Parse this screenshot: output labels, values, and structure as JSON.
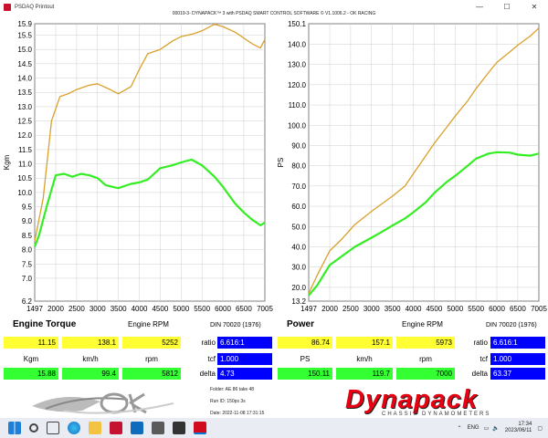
{
  "window": {
    "title": "PSDAQ Printout",
    "controls": [
      "—",
      "☐",
      "✕"
    ]
  },
  "header": {
    "text": "00019-3- DYNAPACK™ 3 with PSDAQ SMART CONTROL SOFTWARE © V1.1006.2 - OK RACING"
  },
  "torque_section": {
    "title": "Engine Torque",
    "xlabel": "Engine RPM",
    "din": "DIN 70020 (1976)",
    "row1": {
      "value": "11.15",
      "kmh": "138.1",
      "rpm": "5252",
      "ratio_label": "ratio",
      "ratio": "6.616:1"
    },
    "units": {
      "u1": "Kgm",
      "u2": "km/h",
      "u3": "rpm",
      "tcf_label": "tcf",
      "tcf": "1.000"
    },
    "row2": {
      "value": "15.88",
      "kmh": "99.4",
      "rpm": "5812",
      "delta_label": "delta",
      "delta": "4.73"
    }
  },
  "power_section": {
    "title": "Power",
    "xlabel": "Engine RPM",
    "din": "DIN 70020 (1976)",
    "row1": {
      "value": "86.74",
      "kmh": "157.1",
      "rpm": "5973",
      "ratio_label": "ratio",
      "ratio": "6.616:1"
    },
    "units": {
      "u1": "PS",
      "u2": "km/h",
      "u3": "rpm",
      "tcf_label": "tcf",
      "tcf": "1.000"
    },
    "row2": {
      "value": "150.11",
      "kmh": "119.7",
      "rpm": "7000",
      "delta_label": "delta",
      "delta": "63.37"
    }
  },
  "footer": {
    "folder": "Folder:   AE 86 take 48",
    "run": "Run ID:   150ps 3s",
    "date": "Date:    2022-11-08 17:31:15",
    "logo_right": "Dynapack",
    "logo_right_sub": "CHASSIS DYNAMOMETERS"
  },
  "taskbar": {
    "lang": "ENG",
    "time": "17:34",
    "date": "2023/06/11"
  },
  "colors": {
    "orange": "#d9a02a",
    "green": "#33ee22",
    "yellow": "#ffff33",
    "blue": "#0000ff"
  },
  "chart_data": [
    {
      "type": "line",
      "ylabel": "Kgm",
      "xlabel": "Engine RPM",
      "xlim": [
        1497,
        7005
      ],
      "ylim": [
        6.2,
        15.9
      ],
      "x_ticks": [
        "1497",
        "2000",
        "2500",
        "3000",
        "3500",
        "4000",
        "4500",
        "5000",
        "5500",
        "6000",
        "6500",
        "7005"
      ],
      "y_ticks": [
        "6.2",
        "7.0",
        "7.5",
        "8.0",
        "8.5",
        "9.0",
        "9.5",
        "10.0",
        "10.5",
        "11.0",
        "11.5",
        "12.0",
        "12.5",
        "13.0",
        "13.5",
        "14.0",
        "14.5",
        "15.0",
        "15.5",
        "15.9"
      ],
      "grid": true,
      "series": [
        {
          "color": "#d9a02a",
          "x": [
            1497,
            1700,
            1900,
            2100,
            2300,
            2500,
            2800,
            3000,
            3300,
            3500,
            3800,
            4000,
            4200,
            4500,
            4800,
            5000,
            5300,
            5500,
            5800,
            6000,
            6300,
            6500,
            6700,
            6900,
            7005
          ],
          "y": [
            8.3,
            9.8,
            12.5,
            13.35,
            13.45,
            13.6,
            13.75,
            13.8,
            13.6,
            13.45,
            13.7,
            14.3,
            14.85,
            15.0,
            15.3,
            15.45,
            15.55,
            15.65,
            15.88,
            15.8,
            15.6,
            15.4,
            15.2,
            15.05,
            15.35
          ]
        },
        {
          "color": "#33ee22",
          "x": [
            1497,
            1600,
            1800,
            2000,
            2200,
            2400,
            2600,
            2800,
            3000,
            3200,
            3500,
            3800,
            4000,
            4200,
            4500,
            4800,
            5000,
            5250,
            5500,
            5800,
            6000,
            6300,
            6500,
            6700,
            6900,
            7005
          ],
          "y": [
            8.1,
            8.5,
            9.6,
            10.6,
            10.65,
            10.55,
            10.65,
            10.6,
            10.5,
            10.25,
            10.15,
            10.3,
            10.35,
            10.45,
            10.85,
            10.95,
            11.05,
            11.15,
            10.95,
            10.55,
            10.2,
            9.6,
            9.3,
            9.05,
            8.85,
            8.95
          ]
        }
      ]
    },
    {
      "type": "line",
      "ylabel": "PS",
      "xlabel": "Engine RPM",
      "xlim": [
        1497,
        7005
      ],
      "ylim": [
        13.2,
        150.1
      ],
      "x_ticks": [
        "1497",
        "2000",
        "2500",
        "3000",
        "3500",
        "4000",
        "4500",
        "5000",
        "5500",
        "6000",
        "6500",
        "7005"
      ],
      "y_ticks": [
        "13.2",
        "20.0",
        "30.0",
        "40.0",
        "50.0",
        "60.0",
        "70.0",
        "80.0",
        "90.0",
        "100.0",
        "110.0",
        "120.0",
        "130.0",
        "140.0",
        "150.1"
      ],
      "grid": true,
      "series": [
        {
          "color": "#d9a02a",
          "x": [
            1497,
            1700,
            2000,
            2300,
            2600,
            3000,
            3300,
            3500,
            3800,
            4000,
            4300,
            4500,
            4800,
            5000,
            5300,
            5500,
            5800,
            6000,
            6300,
            6500,
            6800,
            7005
          ],
          "y": [
            17.0,
            26.0,
            38.0,
            44.0,
            51.0,
            57.5,
            62.0,
            65.0,
            70.0,
            76.0,
            85.0,
            91.0,
            99.0,
            104.5,
            112.0,
            118.0,
            126.0,
            131.0,
            136.0,
            139.5,
            144.0,
            148.0
          ]
        },
        {
          "color": "#33ee22",
          "x": [
            1497,
            1700,
            2000,
            2300,
            2600,
            3000,
            3300,
            3500,
            3800,
            4000,
            4300,
            4500,
            4800,
            5000,
            5300,
            5500,
            5800,
            6000,
            6300,
            6500,
            6800,
            7005
          ],
          "y": [
            16.0,
            21.0,
            31.0,
            35.5,
            40.0,
            44.5,
            48.0,
            50.5,
            54.0,
            57.0,
            62.0,
            66.5,
            72.0,
            75.0,
            80.0,
            83.5,
            86.0,
            86.7,
            86.5,
            85.5,
            85.0,
            86.0
          ]
        }
      ]
    }
  ]
}
